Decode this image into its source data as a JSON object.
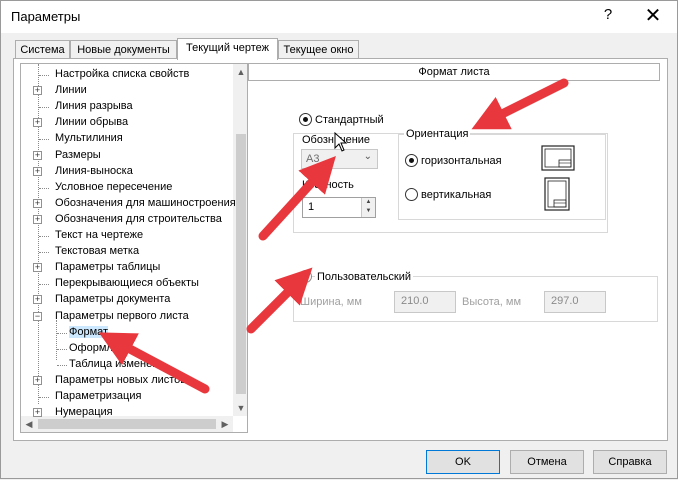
{
  "window": {
    "title": "Параметры",
    "help": "?",
    "close": "✕"
  },
  "tabs": [
    {
      "label": "Система"
    },
    {
      "label": "Новые документы"
    },
    {
      "label": "Текущий чертеж"
    },
    {
      "label": "Текущее окно"
    }
  ],
  "active_tab_index": 2,
  "tree": {
    "items": [
      {
        "label": "Настройка списка свойств",
        "expander": ""
      },
      {
        "label": "Линии",
        "expander": "+"
      },
      {
        "label": "Линия разрыва",
        "expander": ""
      },
      {
        "label": "Линии обрыва",
        "expander": "+"
      },
      {
        "label": "Мультилиния",
        "expander": ""
      },
      {
        "label": "Размеры",
        "expander": "+"
      },
      {
        "label": "Линия-выноска",
        "expander": "+"
      },
      {
        "label": "Условное пересечение",
        "expander": ""
      },
      {
        "label": "Обозначения для машиностроения",
        "expander": "+"
      },
      {
        "label": "Обозначения для строительства",
        "expander": "+"
      },
      {
        "label": "Текст на чертеже",
        "expander": ""
      },
      {
        "label": "Текстовая метка",
        "expander": ""
      },
      {
        "label": "Параметры таблицы",
        "expander": "+"
      },
      {
        "label": "Перекрывающиеся объекты",
        "expander": ""
      },
      {
        "label": "Параметры документа",
        "expander": "+"
      },
      {
        "label": "Параметры первого листа",
        "expander": "−"
      },
      {
        "label": "Формат",
        "expander": "",
        "child": true,
        "selected": true
      },
      {
        "label": "Оформлени",
        "expander": "",
        "child": true
      },
      {
        "label": "Таблица изменен",
        "expander": "",
        "child": true
      },
      {
        "label": "Параметры новых листов",
        "expander": "+"
      },
      {
        "label": "Параметризация",
        "expander": ""
      },
      {
        "label": "Нумерация",
        "expander": "+"
      }
    ]
  },
  "panel": {
    "header": "Формат листа",
    "standard": {
      "label": "Стандартный",
      "checked": true,
      "designation_label": "Обозначение",
      "designation_value": "A3",
      "multiplicity_label": "Кратность",
      "multiplicity_value": "1"
    },
    "orientation": {
      "title": "Ориентация",
      "horizontal_label": "горизонтальная",
      "horizontal_checked": true,
      "vertical_label": "вертикальная",
      "vertical_checked": false
    },
    "custom": {
      "label": "Пользовательский",
      "checked": false,
      "width_label": "Ширина, мм",
      "width_value": "210.0",
      "height_label": "Высота, мм",
      "height_value": "297.0"
    }
  },
  "buttons": {
    "ok": "OK",
    "cancel": "Отмена",
    "help": "Справка"
  },
  "colors": {
    "arrow": "#e8383d",
    "selection": "#cce8ff",
    "accent": "#0078d7"
  }
}
